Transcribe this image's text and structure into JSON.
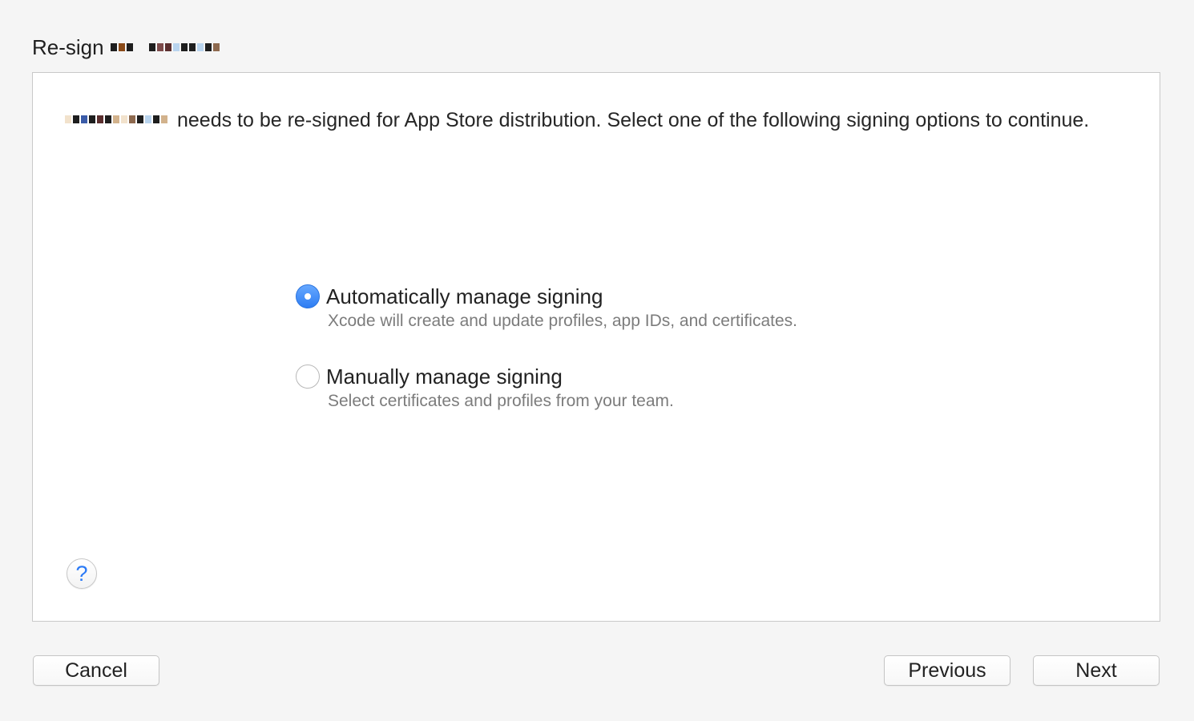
{
  "window": {
    "title": "Re-sign"
  },
  "message": {
    "text": "needs to be re-signed for App Store distribution. Select one of the following signing options to continue."
  },
  "options": [
    {
      "label": "Automatically manage signing",
      "description": "Xcode will create and update profiles, app IDs, and certificates.",
      "selected": true
    },
    {
      "label": "Manually manage signing",
      "description": "Select certificates and profiles from your team.",
      "selected": false
    }
  ],
  "help": {
    "label": "?"
  },
  "footer": {
    "cancel": "Cancel",
    "previous": "Previous",
    "next": "Next"
  },
  "colors": {
    "accent": "#2e7df3",
    "panel_border": "#c9c9c9",
    "background": "#f5f5f5"
  },
  "icons": {
    "help": "help-icon",
    "selected_radio": "radio-selected-icon",
    "unselected_radio": "radio-unselected-icon"
  }
}
